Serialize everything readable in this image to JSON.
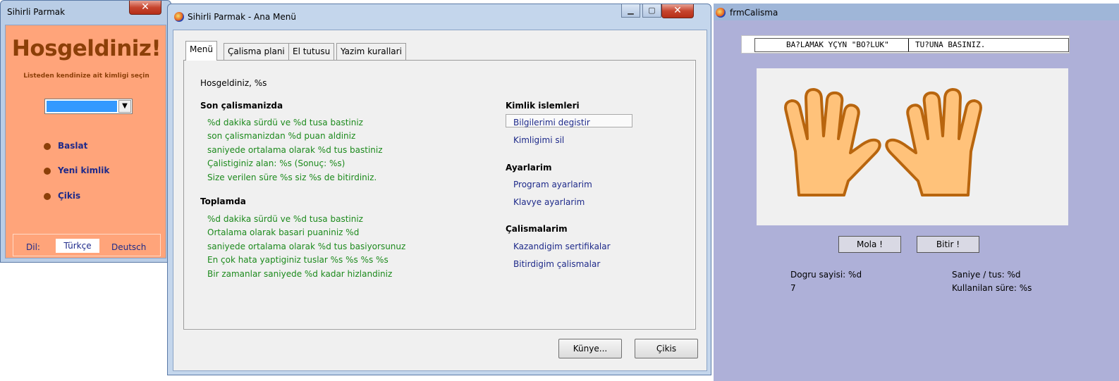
{
  "login_window": {
    "title": "Sihirli Parmak",
    "close_label": "✕",
    "heading": "Hosgeldiniz!",
    "subheading": "Listeden kendinize ait kimligi seçin",
    "identity_select": {
      "selected_value": "",
      "arrow": "▼"
    },
    "menu": [
      {
        "label": "Baslat"
      },
      {
        "label": "Yeni kimlik"
      },
      {
        "label": "Çikis"
      }
    ],
    "language": {
      "label": "Dil:",
      "options": [
        "Türkçe",
        "Deutsch"
      ],
      "selected": "Türkçe"
    },
    "colors": {
      "background": "#ffa47a",
      "heading": "#8c3f08",
      "link": "#1e2a8a"
    }
  },
  "main_window": {
    "title": "Sihirli Parmak - Ana Menü",
    "controls": {
      "minimize": "▁",
      "maximize": "▢",
      "close": "✕"
    },
    "tabs": [
      {
        "label": "Menü"
      },
      {
        "label": "Çalisma plani"
      },
      {
        "label": "El tutusu"
      },
      {
        "label": "Yazim kurallari"
      }
    ],
    "active_tab": "Menü",
    "welcome": "Hosgeldiniz, %s",
    "last_session": {
      "heading": "Son çalismanizda",
      "lines": [
        "%d dakika sürdü ve %d tusa bastiniz",
        "son çalismanizdan %d puan aldiniz",
        "saniyede ortalama olarak %d tus bastiniz",
        "Çalistiginiz alan: %s (Sonuç: %s)",
        "Size verilen süre %s siz %s de bitirdiniz."
      ]
    },
    "total": {
      "heading": "Toplamda",
      "lines": [
        "%d dakika sürdü ve %d tusa bastiniz",
        "Ortalama olarak basari puaniniz %d",
        "saniyede ortalama olarak %d tus basiyorsunuz",
        "En çok hata yaptiginiz tuslar %s %s %s %s",
        "Bir zamanlar saniyede %d kadar hizlandiniz"
      ]
    },
    "identity_ops": {
      "heading": "Kimlik islemleri",
      "links": [
        "Bilgilerimi degistir",
        "Kimligimi sil"
      ]
    },
    "settings": {
      "heading": "Ayarlarim",
      "links": [
        "Program ayarlarim",
        "Klavye ayarlarim"
      ]
    },
    "works": {
      "heading": "Çalismalarim",
      "links": [
        "Kazandigim sertifikalar",
        "Bitirdigim çalismalar"
      ]
    },
    "buttons": {
      "about": "Künye...",
      "exit": "Çikis"
    },
    "colors": {
      "green_text": "#1c8a1c",
      "link": "#1e2a8a"
    }
  },
  "practice_window": {
    "title": "frmCalisma",
    "prompt_part1": "BA?LAMAK YÇYN \"BO?LUK\"",
    "prompt_part2": "TU?UNA BASINIZ.",
    "buttons": {
      "pause": "Mola !",
      "finish": "Bitir !"
    },
    "stats": {
      "correct_label": "Dogru sayisi: %d",
      "correct_value": "7",
      "per_key_label": "Saniye / tus: %d",
      "used_time_label": "Kullanilan süre: %s"
    },
    "colors": {
      "background": "#aeb0d8",
      "hand_fill": "#ffc27a",
      "hand_stroke": "#b8650e"
    }
  }
}
